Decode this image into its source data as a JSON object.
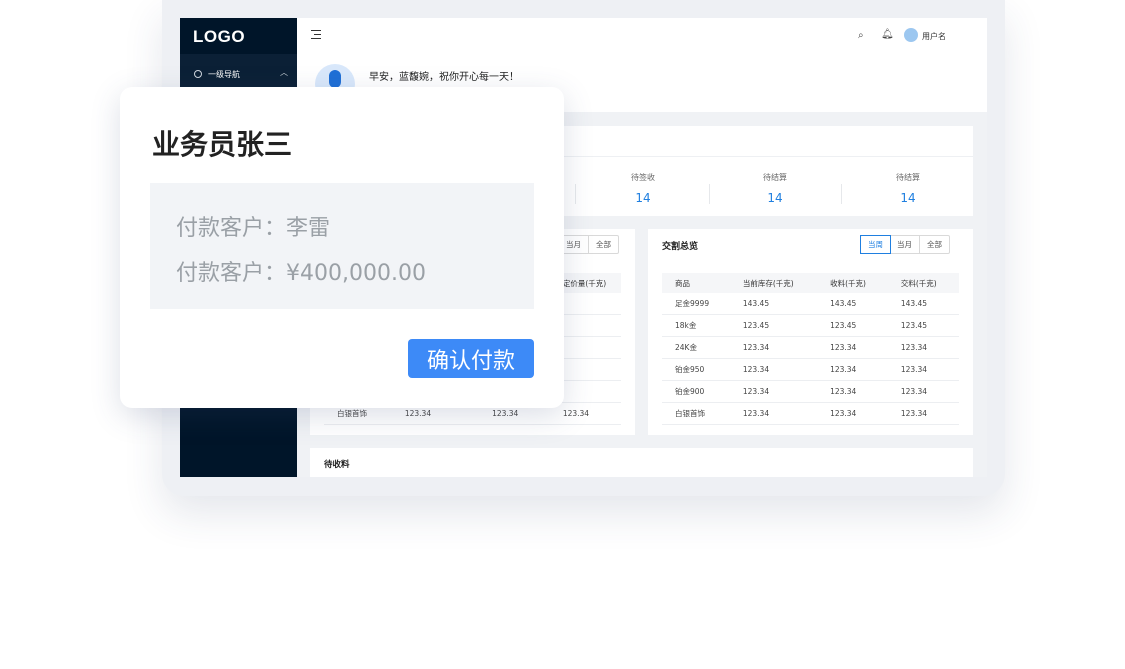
{
  "sidebar": {
    "logo": "LOGO",
    "nav": [
      {
        "label": "一级导航",
        "expanded": true
      }
    ]
  },
  "header": {
    "user_name": "用户名",
    "greeting": "早安，蓝馥婉，祝你开心每一天！"
  },
  "stats": [
    {
      "label": "待签收",
      "value": "14"
    },
    {
      "label": "待结算",
      "value": "14"
    },
    {
      "label": "待结算",
      "value": "14"
    }
  ],
  "left_table": {
    "filters": [
      "当月",
      "全部"
    ],
    "columns": [
      "",
      "",
      "",
      "定价量(千克)"
    ],
    "rows": [
      [
        "白银首饰",
        "123.34",
        "123.34",
        "123.34"
      ]
    ]
  },
  "right_table": {
    "title": "交割总览",
    "filters": [
      "当周",
      "当月",
      "全部"
    ],
    "active_filter": "当周",
    "columns": [
      "商品",
      "当前库存(千克)",
      "收料(千克)",
      "交料(千克)"
    ],
    "rows": [
      [
        "足金9999",
        "143.45",
        "143.45",
        "143.45"
      ],
      [
        "18k金",
        "123.45",
        "123.45",
        "123.45"
      ],
      [
        "24K金",
        "123.34",
        "123.34",
        "123.34"
      ],
      [
        "铂金950",
        "123.34",
        "123.34",
        "123.34"
      ],
      [
        "铂金900",
        "123.34",
        "123.34",
        "123.34"
      ],
      [
        "白银首饰",
        "123.34",
        "123.34",
        "123.34"
      ]
    ]
  },
  "pending": {
    "title": "待收料"
  },
  "popup": {
    "name": "业务员张三",
    "customer_line": "付款客户：李雷",
    "amount_line": "付款客户：¥400,000.00",
    "confirm_label": "确认付款"
  },
  "colors": {
    "accent": "#3d8af7",
    "sidebar": "#001529",
    "stat_value": "#1f7fe0"
  }
}
